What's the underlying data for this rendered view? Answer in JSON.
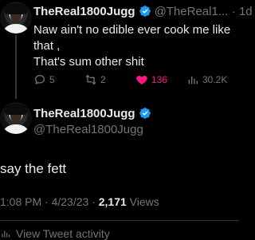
{
  "reply": {
    "name": "TheReal1800Jugg",
    "handle": "@TheReal1...",
    "time": "· 1d",
    "text_line1": "Naw ain't no edible ever cook me like",
    "text_line2": "that ,",
    "text_line3": "That's sum other shit",
    "replies": "5",
    "retweets": "2",
    "likes": "136",
    "views": "30.2K"
  },
  "main": {
    "name": "TheReal1800Jugg",
    "handle": "@TheReal1800Jugg",
    "text": "say the fett",
    "time": "1:08 PM · 4/23/23 · ",
    "views_count": "2,171",
    "views_label": " Views"
  },
  "activity": {
    "label": "View Tweet activity"
  },
  "colors": {
    "background": "#000000",
    "verified": "#1d9bf0",
    "like": "#f91880"
  },
  "icons": [
    "reply-icon",
    "retweet-icon",
    "heart-icon",
    "views-icon",
    "verified-badge-icon",
    "activity-icon"
  ]
}
